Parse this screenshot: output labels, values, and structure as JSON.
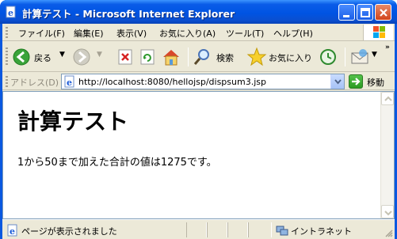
{
  "window": {
    "title": "計算テスト - Microsoft Internet Explorer"
  },
  "menu": {
    "items": [
      {
        "label": "ファイル(F)"
      },
      {
        "label": "編集(E)"
      },
      {
        "label": "表示(V)"
      },
      {
        "label": "お気に入り(A)"
      },
      {
        "label": "ツール(T)"
      },
      {
        "label": "ヘルプ(H)"
      }
    ]
  },
  "toolbar": {
    "back_label": "戻る",
    "search_label": "検索",
    "favorites_label": "お気に入り"
  },
  "address": {
    "label": "アドレス(D)",
    "url": "http://localhost:8080/hellojsp/dispsum3.jsp",
    "go_label": "移動"
  },
  "page": {
    "heading": "計算テスト",
    "text": "1から50まで加えた合計の値は1275です。"
  },
  "status": {
    "text": "ページが表示されました",
    "zone": "イントラネット"
  },
  "colors": {
    "titlebar": "#0054e3",
    "frame": "#ece9d8",
    "close_button": "#d2441a"
  }
}
